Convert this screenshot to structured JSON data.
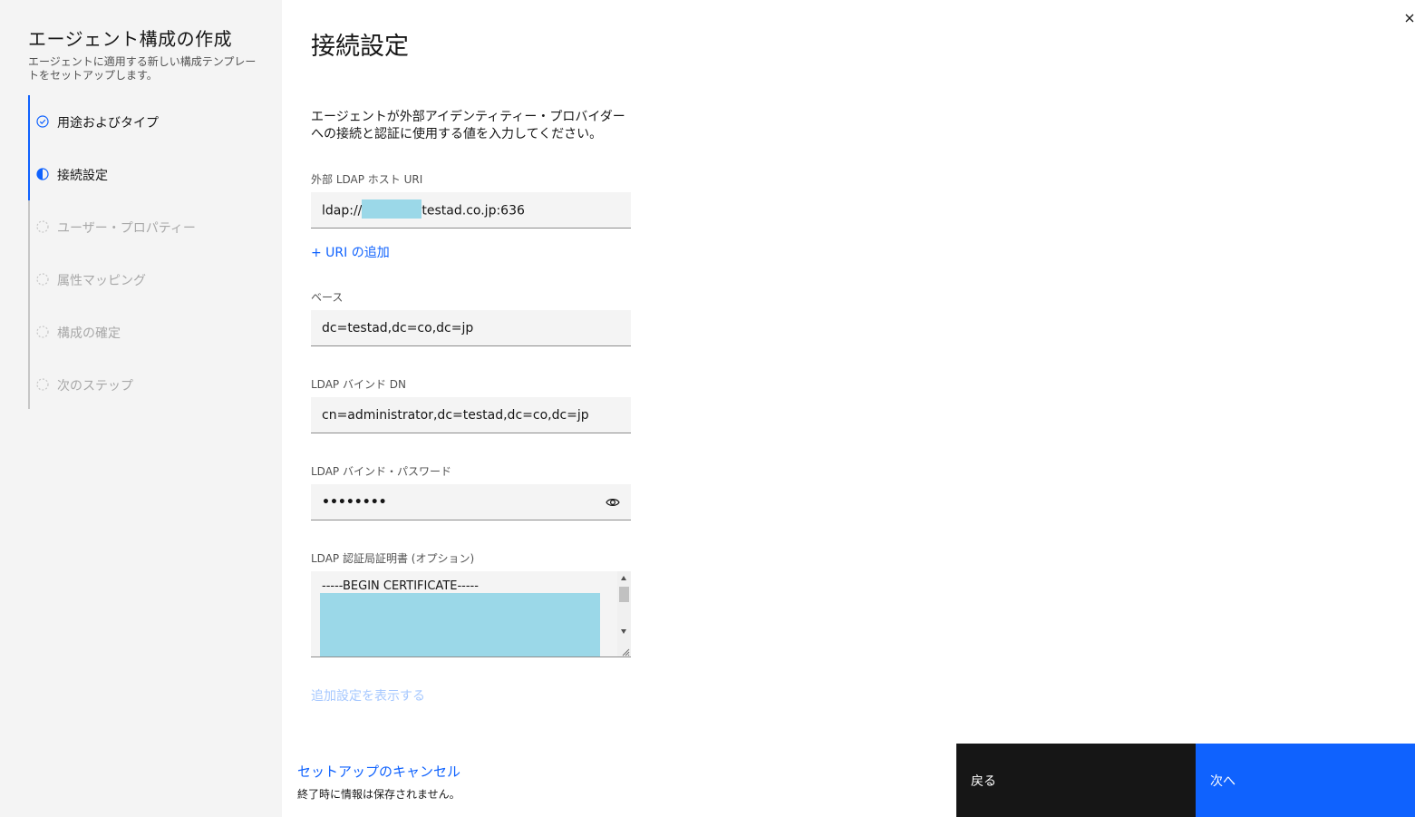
{
  "sidebar": {
    "title": "エージェント構成の作成",
    "description": "エージェントに適用する新しい構成テンプレートをセットアップします。",
    "steps": [
      {
        "label": "用途およびタイプ",
        "state": "complete",
        "icon": "checkmark-outline-icon"
      },
      {
        "label": "接続設定",
        "state": "current",
        "icon": "incomplete-half-icon"
      },
      {
        "label": "ユーザー・プロパティー",
        "state": "incomplete",
        "icon": "dashed-circle-icon"
      },
      {
        "label": "属性マッピング",
        "state": "incomplete",
        "icon": "dashed-circle-icon"
      },
      {
        "label": "構成の確定",
        "state": "incomplete",
        "icon": "dashed-circle-icon"
      },
      {
        "label": "次のステップ",
        "state": "incomplete",
        "icon": "dashed-circle-icon"
      }
    ]
  },
  "main": {
    "title": "接続設定",
    "intro": "エージェントが外部アイデンティティー・プロバイダーへの接続と認証に使用する値を入力してください。",
    "ldap_uri": {
      "label": "外部 LDAP ホスト URI",
      "value_prefix": "ldap://",
      "value_suffix": "testad.co.jp:636"
    },
    "add_uri_link": "+ URI の追加",
    "base": {
      "label": "ベース",
      "value": "dc=testad,dc=co,dc=jp"
    },
    "bind_dn": {
      "label": "LDAP バインド DN",
      "value": "cn=administrator,dc=testad,dc=co,dc=jp"
    },
    "bind_password": {
      "label": "LDAP バインド・パスワード",
      "value": "••••••••",
      "toggle_icon": "eye-icon"
    },
    "ca_cert": {
      "label": "LDAP 認証局証明書 (オプション)",
      "first_line": "-----BEGIN CERTIFICATE-----"
    },
    "show_advanced_link": "追加設定を表示する"
  },
  "footer": {
    "cancel_link": "セットアップのキャンセル",
    "cancel_note": "終了時に情報は保存されません。",
    "back_button": "戻る",
    "next_button": "次へ"
  },
  "colors": {
    "accent": "#0f62fe",
    "dark_button": "#161616",
    "redaction": "#9bd8e8",
    "field_bg": "#f4f4f4"
  }
}
